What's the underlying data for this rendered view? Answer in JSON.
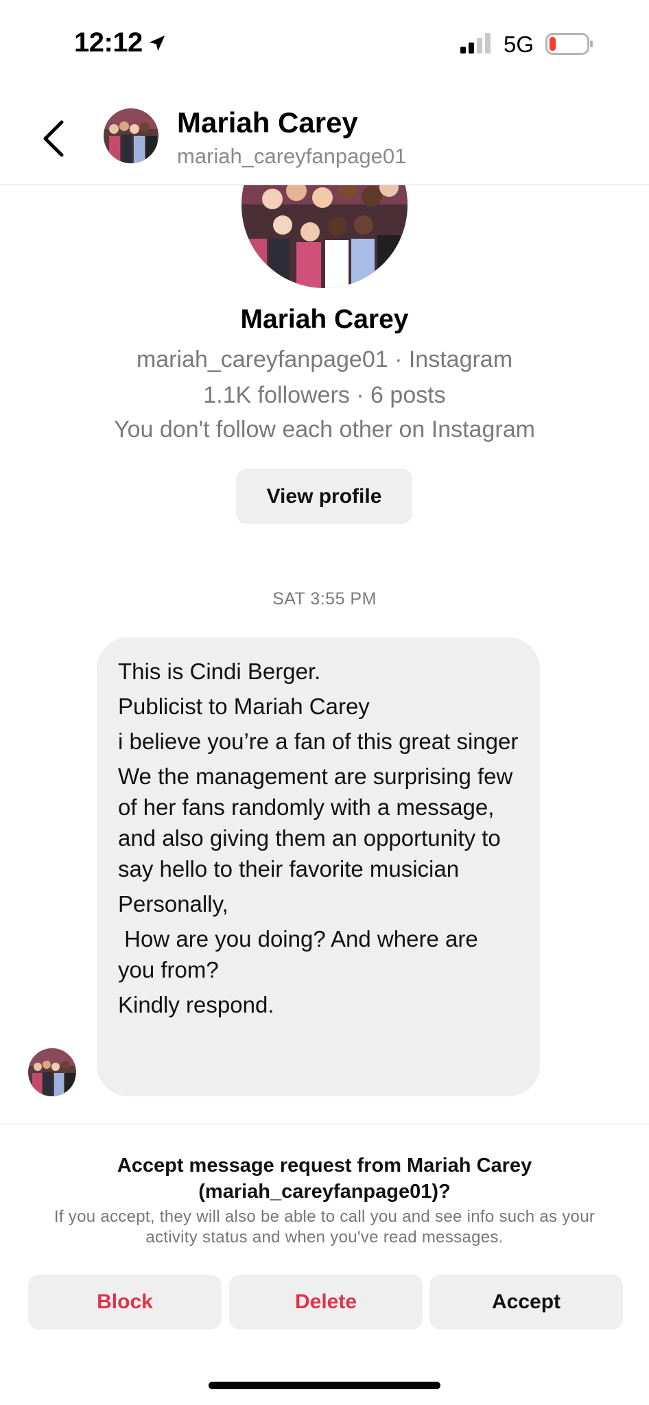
{
  "status_bar": {
    "time": "12:12",
    "network": "5G",
    "icons": [
      "location-arrow-icon",
      "signal-icon",
      "battery-low-icon"
    ],
    "battery_color": "#ff3b30"
  },
  "header": {
    "name": "Mariah Carey",
    "handle": "mariah_careyfanpage01",
    "back_icon": "chevron-left-icon"
  },
  "profile": {
    "name": "Mariah Carey",
    "meta_line1": "mariah_careyfanpage01 · Instagram",
    "meta_line2": "1.1K followers · 6 posts",
    "meta_line3": "You don't follow each other on Instagram",
    "view_profile_label": "View profile"
  },
  "conversation": {
    "timestamp": "SAT 3:55 PM",
    "message_lines": [
      "This is Cindi Berger.",
      "Publicist to Mariah Carey",
      "i believe you’re a fan of this great singer",
      "We the management are surprising few of her fans randomly with a message, and also giving them an opportunity to say hello to their favorite musician",
      "Personally,",
      " How are you doing? And where are you from?",
      "Kindly respond."
    ]
  },
  "request_panel": {
    "title": "Accept message request from Mariah Carey (mariah_careyfanpage01)?",
    "body": "If you accept, they will also be able to call you and see info such as your activity status and when you've read messages.",
    "block_label": "Block",
    "delete_label": "Delete",
    "accept_label": "Accept",
    "danger_color": "#e0334a"
  }
}
